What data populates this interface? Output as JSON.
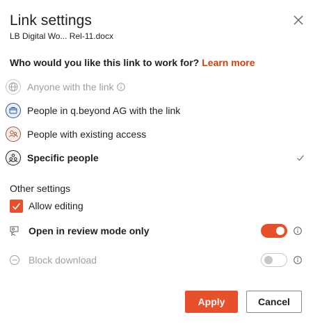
{
  "dialog": {
    "title": "Link settings",
    "filename": "LB Digital Wo... Rel-11.docx",
    "question": "Who would you like this link to work for?",
    "learn_more": "Learn more"
  },
  "options": [
    {
      "label": "Anyone with the link",
      "icon": "globe-icon",
      "disabled": true,
      "has_info": true
    },
    {
      "label": "People in q.beyond AG with the link",
      "icon": "building-icon",
      "disabled": false
    },
    {
      "label": "People with existing access",
      "icon": "people-icon",
      "disabled": false
    },
    {
      "label": "Specific people",
      "icon": "specific-people-icon",
      "selected": true
    }
  ],
  "other_settings": {
    "heading": "Other settings",
    "allow_editing": {
      "label": "Allow editing",
      "checked": true
    },
    "review_mode": {
      "label": "Open in review mode only",
      "enabled": true
    },
    "block_download": {
      "label": "Block download",
      "enabled": false,
      "disabled": true
    }
  },
  "buttons": {
    "apply": "Apply",
    "cancel": "Cancel"
  },
  "colors": {
    "accent": "#e8502a",
    "learn_more": "#d83b01",
    "disabled_text": "#a19f9d"
  }
}
